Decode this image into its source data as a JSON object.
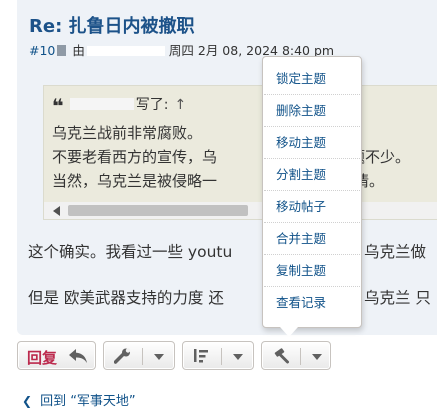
{
  "post": {
    "title": "Re: 扎鲁日内被撤职",
    "number": "#10",
    "by": "由",
    "date": "周四 2月 08, 2024 8:40 pm",
    "quote": {
      "wrote": "写了:",
      "lines": [
        "乌克兰战前非常腐败。",
        "不要老看西方的宣传，乌",
        "题不少。",
        "当然，乌克兰是被侵略一",
        "情。"
      ]
    },
    "body": {
      "line1_a": "这个确实。我看过一些 youtu",
      "line1_b": "乌克兰做",
      "line2_a": "但是 欧美武器支持的力度 还",
      "line2_b": "乌克兰 只"
    }
  },
  "dropdown_menu": {
    "items": [
      {
        "label": "锁定主题"
      },
      {
        "label": "删除主题"
      },
      {
        "label": "移动主题"
      },
      {
        "label": "分割主题"
      },
      {
        "label": "移动帖子"
      },
      {
        "label": "合并主题"
      },
      {
        "label": "复制主题"
      },
      {
        "label": "查看记录"
      }
    ]
  },
  "toolbar": {
    "reply_label": "回复"
  },
  "footer": {
    "back_link": "回到 “军事天地”"
  },
  "icons": {
    "post_link": "document-icon",
    "reply": "reply-arrow-icon",
    "tools": "wrench-icon",
    "sort": "sort-icon",
    "moderate": "gavel-icon",
    "back": "chevron-left-icon",
    "quote": "quote-icon"
  },
  "colors": {
    "post_background": "#eef2f7",
    "title": "#1c5289",
    "link": "#105289",
    "reply_text": "#bc2a4d",
    "quote_background": "#ebeadd"
  }
}
